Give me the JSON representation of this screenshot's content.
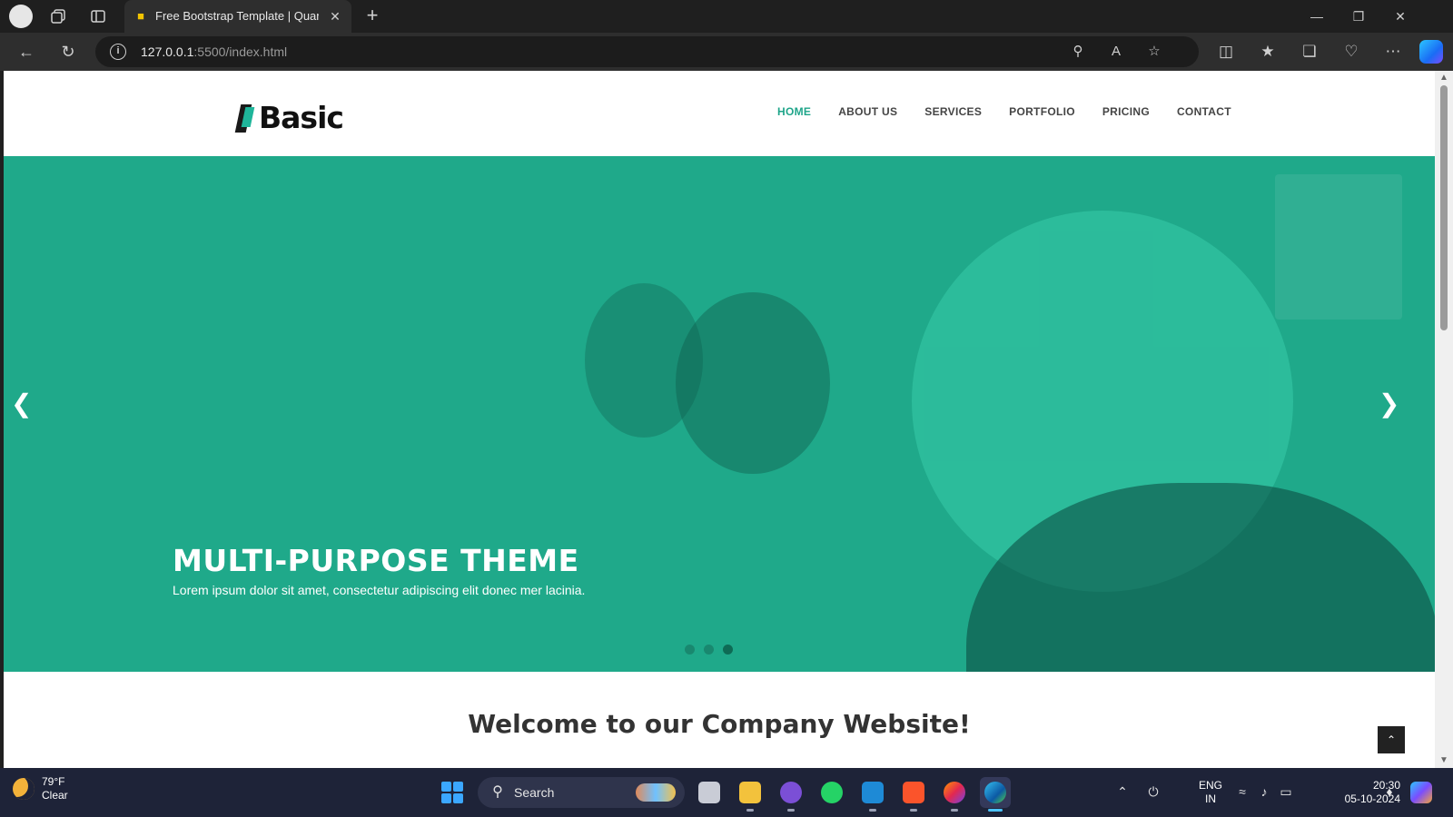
{
  "browser": {
    "tab_title": "Free Bootstrap Template | Quantum",
    "url_host": "127.0.0.1",
    "url_rest": ":5500/index.html",
    "icons": {
      "profile": "profile-icon",
      "workspaces": "workspaces-icon",
      "vertical_tabs": "vertical-tabs-icon",
      "back": "back-arrow-icon",
      "refresh": "refresh-icon",
      "site_info": "info-icon",
      "zoom": "zoom-out-icon",
      "read_aloud": "read-aloud-icon",
      "favorite": "star-icon",
      "split": "split-screen-icon",
      "favorites": "favorites-icon",
      "collections": "collections-icon",
      "health": "browser-essentials-icon",
      "more": "more-icon",
      "copilot": "copilot-icon"
    }
  },
  "site": {
    "logo_text": "Basic",
    "nav": [
      {
        "label": "HOME",
        "active": true
      },
      {
        "label": "ABOUT US",
        "active": false
      },
      {
        "label": "SERVICES",
        "active": false
      },
      {
        "label": "PORTFOLIO",
        "active": false
      },
      {
        "label": "PRICING",
        "active": false
      },
      {
        "label": "CONTACT",
        "active": false
      }
    ],
    "hero": {
      "headline": "MULTI-PURPOSE THEME",
      "subtext": "Lorem ipsum dolor sit amet, consectetur adipiscing elit donec mer lacinia.",
      "slide_count": 3,
      "active_slide": 3
    },
    "welcome_heading": "Welcome to our Company Website!",
    "colors": {
      "accent": "#1fa58a",
      "hero_overlay": "#1fa98a"
    }
  },
  "taskbar": {
    "weather_temp": "79°F",
    "weather_desc": "Clear",
    "search_label": "Search",
    "lang_line1": "ENG",
    "lang_line2": "IN",
    "time": "20:30",
    "date": "05-10-2024",
    "apps": [
      "task-view",
      "file-explorer",
      "github-desktop",
      "whatsapp",
      "vscode",
      "brave",
      "firefox",
      "edge"
    ]
  }
}
